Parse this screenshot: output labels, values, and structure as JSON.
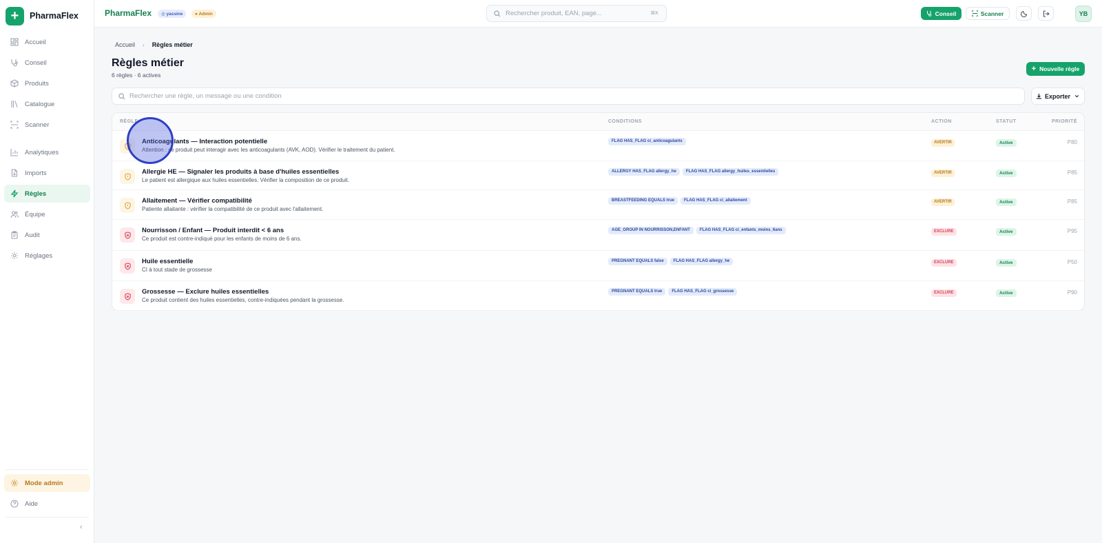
{
  "sidebar": {
    "brand": "PharmaFlex",
    "brand_logo": "+",
    "items": [
      {
        "label": "Accueil",
        "icon": "dashboard-icon"
      },
      {
        "label": "Conseil",
        "icon": "stethoscope-icon"
      },
      {
        "label": "Produits",
        "icon": "box-icon"
      },
      {
        "label": "Catalogue",
        "icon": "library-icon"
      },
      {
        "label": "Scanner",
        "icon": "scan-icon"
      },
      {
        "label": "Analytiques",
        "icon": "chart-icon"
      },
      {
        "label": "Imports",
        "icon": "file-import-icon"
      },
      {
        "label": "Règles",
        "icon": "zap-icon",
        "active": true
      },
      {
        "label": "Équipe",
        "icon": "users-icon"
      },
      {
        "label": "Audit",
        "icon": "clipboard-icon"
      },
      {
        "label": "Réglages",
        "icon": "gear-icon"
      }
    ],
    "admin_mode": "Mode admin",
    "help": "Aide",
    "collapse": "‹"
  },
  "topbar": {
    "brand": "PharmaFlex",
    "user_chip": "◎ yassine",
    "admin_chip": "● Admin",
    "search_placeholder": "Rechercher produit, EAN, page...",
    "search_shortcut": "⌘K",
    "conseil_label": "Conseil",
    "scanner_label": "Scanner",
    "avatar": "YB"
  },
  "breadcrumb": {
    "home": "Accueil",
    "separator": "›",
    "current": "Règles métier"
  },
  "page": {
    "title": "Règles métier",
    "subtitle": "6 règles · 6 actives",
    "new_button": "Nouvelle règle",
    "search_placeholder": "Rechercher une règle, un message ou une condition",
    "export_label": "Exporter"
  },
  "table": {
    "headers": {
      "rule": "RÈGLE",
      "conditions": "CONDITIONS",
      "action": "ACTION",
      "status": "STATUT",
      "priority": "PRIORITÉ"
    },
    "rows": [
      {
        "title": "Anticoagulants — Interaction potentielle",
        "desc": "Attention : ce produit peut interagir avec les anticoagulants (AVK, AOD). Vérifier le traitement du patient.",
        "conditions": [
          "FLAG HAS_FLAG ci_anticoagulants"
        ],
        "action": "AVERTIR",
        "type": "warn",
        "status": "Active",
        "priority": "P80"
      },
      {
        "title": "Allergie HE — Signaler les produits à base d'huiles essentielles",
        "desc": "Le patient est allergique aux huiles essentielles. Vérifier la composition de ce produit.",
        "conditions": [
          "ALLERGY HAS_FLAG allergy_he",
          "FLAG HAS_FLAG allergy_huiles_essentielles"
        ],
        "action": "AVERTIR",
        "type": "warn",
        "status": "Active",
        "priority": "P85"
      },
      {
        "title": "Allaitement — Vérifier compatibilité",
        "desc": "Patiente allaitante : vérifier la compatibilité de ce produit avec l'allaitement.",
        "conditions": [
          "BREASTFEEDING EQUALS true",
          "FLAG HAS_FLAG ci_allaitement"
        ],
        "action": "AVERTIR",
        "type": "warn",
        "status": "Active",
        "priority": "P85"
      },
      {
        "title": "Nourrisson / Enfant — Produit interdit < 6 ans",
        "desc": "Ce produit est contre-indiqué pour les enfants de moins de 6 ans.",
        "conditions": [
          "AGE_GROUP IN NOURRISSON,ENFANT",
          "FLAG HAS_FLAG ci_enfants_moins_6ans"
        ],
        "action": "EXCLURE",
        "type": "excl",
        "status": "Active",
        "priority": "P95"
      },
      {
        "title": "Huile essentielle",
        "desc": "CI à tout stade de grossesse",
        "conditions": [
          "PREGNANT EQUALS false",
          "FLAG HAS_FLAG allergy_he"
        ],
        "action": "EXCLURE",
        "type": "excl",
        "status": "Active",
        "priority": "P50"
      },
      {
        "title": "Grossesse — Exclure huiles essentielles",
        "desc": "Ce produit contient des huiles essentielles, contre-indiquées pendant la grossesse.",
        "conditions": [
          "PREGNANT EQUALS true",
          "FLAG HAS_FLAG ci_grossesse"
        ],
        "action": "EXCLURE",
        "type": "excl",
        "status": "Active",
        "priority": "P90"
      }
    ]
  },
  "colors": {
    "brand": "#16a36b",
    "warn": "#b7791f",
    "exclude": "#d94057",
    "cursor": "#2d3fc4"
  }
}
